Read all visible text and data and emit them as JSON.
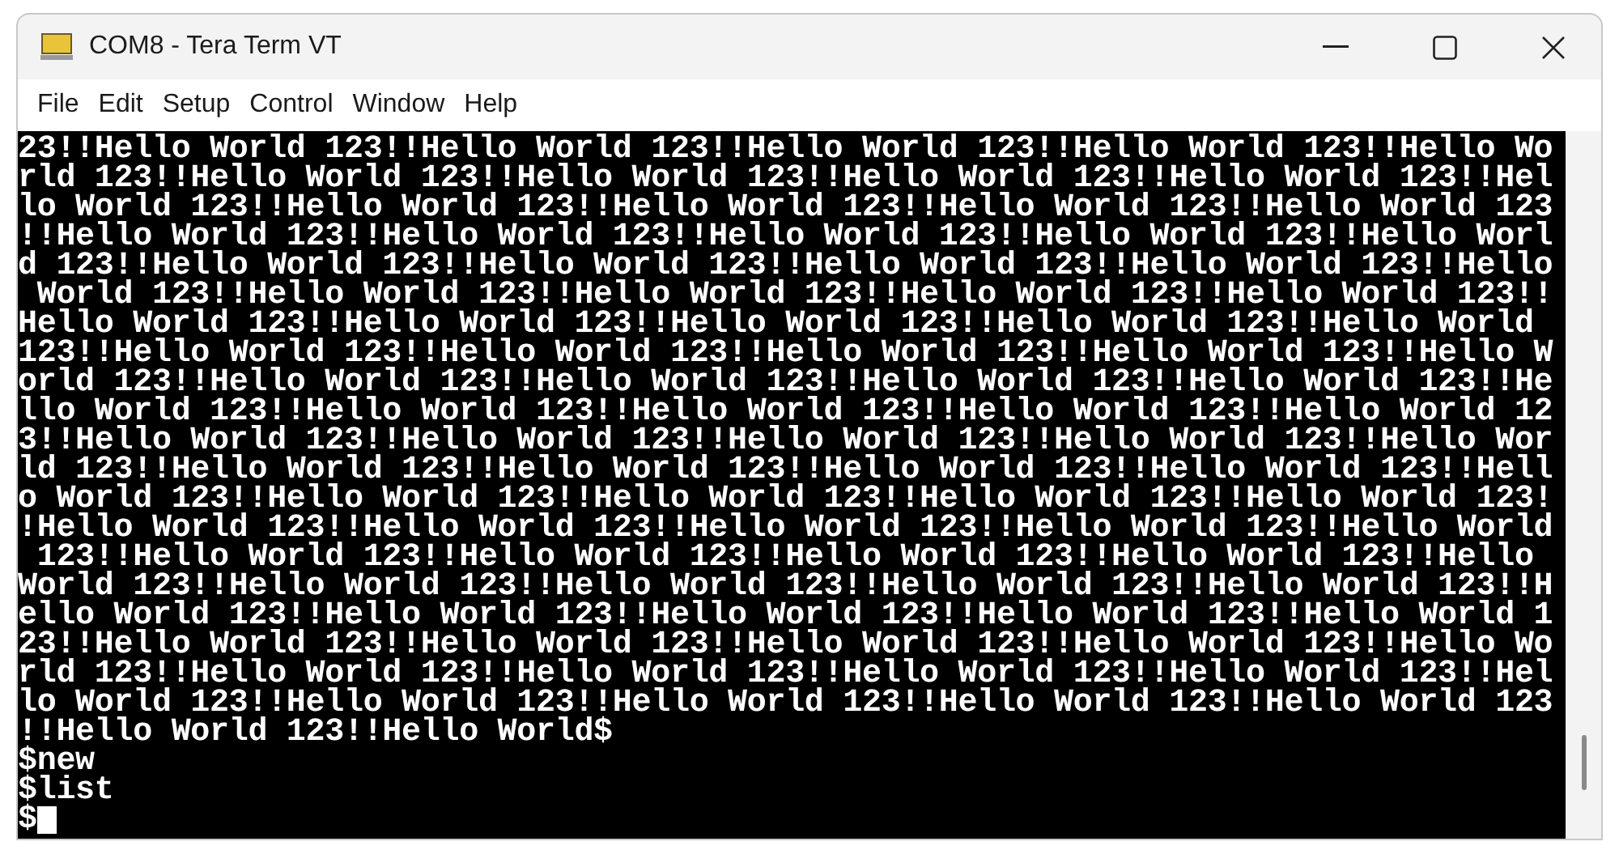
{
  "window": {
    "title": "COM8 - Tera Term VT"
  },
  "menu": [
    "File",
    "Edit",
    "Setup",
    "Control",
    "Window",
    "Help"
  ],
  "terminal": {
    "lines": [
      "23!!Hello World 123!!Hello World 123!!Hello World 123!!Hello World 123!!Hello Wo",
      "rld 123!!Hello World 123!!Hello World 123!!Hello World 123!!Hello World 123!!Hel",
      "lo World 123!!Hello World 123!!Hello World 123!!Hello World 123!!Hello World 123",
      "!!Hello World 123!!Hello World 123!!Hello World 123!!Hello World 123!!Hello Worl",
      "d 123!!Hello World 123!!Hello World 123!!Hello World 123!!Hello World 123!!Hello",
      " World 123!!Hello World 123!!Hello World 123!!Hello World 123!!Hello World 123!!",
      "Hello World 123!!Hello World 123!!Hello World 123!!Hello World 123!!Hello World",
      "123!!Hello World 123!!Hello World 123!!Hello World 123!!Hello World 123!!Hello W",
      "orld 123!!Hello World 123!!Hello World 123!!Hello World 123!!Hello World 123!!He",
      "llo World 123!!Hello World 123!!Hello World 123!!Hello World 123!!Hello World 12",
      "3!!Hello World 123!!Hello World 123!!Hello World 123!!Hello World 123!!Hello Wor",
      "ld 123!!Hello World 123!!Hello World 123!!Hello World 123!!Hello World 123!!Hell",
      "o World 123!!Hello World 123!!Hello World 123!!Hello World 123!!Hello World 123!",
      "!Hello World 123!!Hello World 123!!Hello World 123!!Hello World 123!!Hello World",
      " 123!!Hello World 123!!Hello World 123!!Hello World 123!!Hello World 123!!Hello",
      "World 123!!Hello World 123!!Hello World 123!!Hello World 123!!Hello World 123!!H",
      "ello World 123!!Hello World 123!!Hello World 123!!Hello World 123!!Hello World 1",
      "23!!Hello World 123!!Hello World 123!!Hello World 123!!Hello World 123!!Hello Wo",
      "rld 123!!Hello World 123!!Hello World 123!!Hello World 123!!Hello World 123!!Hel",
      "lo World 123!!Hello World 123!!Hello World 123!!Hello World 123!!Hello World 123",
      "!!Hello World 123!!Hello World$",
      "$new",
      "$list",
      "$"
    ]
  }
}
